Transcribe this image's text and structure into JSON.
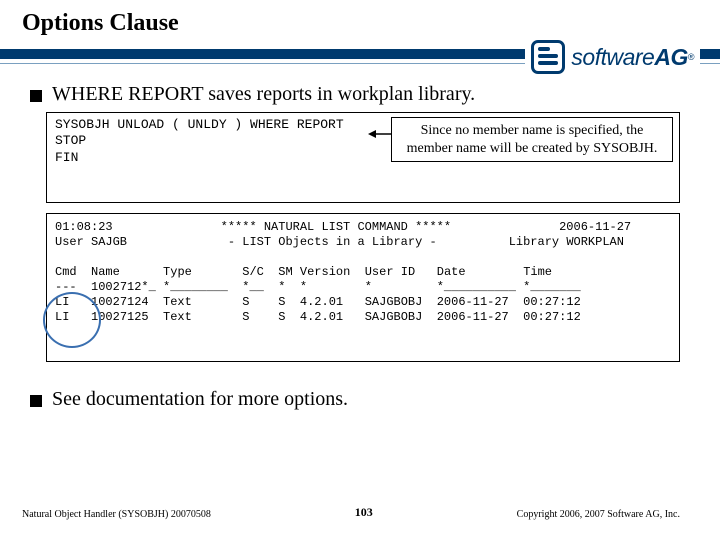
{
  "title": "Options Clause",
  "brand": {
    "part1": "software",
    "part2": " AG",
    "reg": "®"
  },
  "bullet1": "WHERE REPORT saves reports in workplan library.",
  "cmd": {
    "l1": "SYSOBJH UNLOAD ( UNLDY ) WHERE REPORT",
    "l2": "STOP",
    "l3": "FIN"
  },
  "callout": "Since no member name is specified, the member name will be created by SYSOBJH.",
  "chart_data": {
    "type": "table",
    "header_left_top": "01:08:23",
    "header_left_bot": "User SAJGB",
    "header_center_top": "***** NATURAL LIST COMMAND *****",
    "header_center_bot": "- LIST Objects in a Library -",
    "header_right_top": "2006-11-27",
    "header_right_bot": "Library WORKPLAN",
    "columns": [
      "Cmd",
      "Name",
      "Type",
      "S/C",
      "SM",
      "Version",
      "User ID",
      "Date",
      "Time"
    ],
    "mask": [
      "---",
      "1002712*_",
      "*________",
      "*__",
      "*",
      "*",
      "*",
      "*__________",
      "*_______"
    ],
    "rows": [
      [
        "LI",
        "10027124",
        "Text",
        "S",
        "S",
        "4.2.01",
        "SAJGBOBJ",
        "2006-11-27",
        "00:27:12"
      ],
      [
        "LI",
        "10027125",
        "Text",
        "S",
        "S",
        "4.2.01",
        "SAJGBOBJ",
        "2006-11-27",
        "00:27:12"
      ]
    ]
  },
  "bullet2": "See documentation for more options.",
  "footer": {
    "left": "Natural Object Handler (SYSOBJH) 20070508",
    "page": "103",
    "right": "Copyright 2006, 2007 Software AG, Inc."
  }
}
